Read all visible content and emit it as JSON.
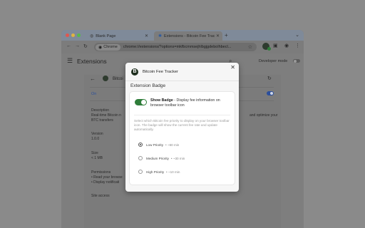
{
  "browser": {
    "tabs": [
      {
        "title": "Blank Page",
        "active": false
      },
      {
        "title": "Extensions - Bitcoin Fee Trac",
        "active": true
      }
    ],
    "url_chip": "Chrome",
    "url": "chrome://extensions/?options=mkfbcmmsejhlbgjgdebolhbecl..."
  },
  "extensions_page": {
    "title": "Extensions",
    "developer_mode_label": "Developer mode",
    "extension_name": "Bitcoi",
    "on_label": "On",
    "description_heading": "Description",
    "description_lines": [
      "Real-time Bitcoin n",
      "BTC transfers"
    ],
    "description_tail": "and optimize your",
    "version_heading": "Version",
    "version_value": "1.0.0",
    "size_heading": "Size",
    "size_value": "< 1 MB",
    "permissions_heading": "Permissions",
    "permissions": [
      "• Read your browse",
      "• Display notificati"
    ],
    "site_access_heading": "Site access"
  },
  "dialog": {
    "title": "Bitcoin Fee Tracker",
    "section_title": "Extension Badge",
    "show_badge_label": "Show Badge",
    "show_badge_desc": " - Display fee information on browser toolbar icon",
    "show_badge_enabled": true,
    "priority_desc": "Select which Bitcoin fee priority to display on your browser toolbar icon. The badge will show the current fee rate and update automatically.",
    "options": [
      {
        "label": "Low Priority",
        "time": "~60 min",
        "selected": true
      },
      {
        "label": "Medium Priority",
        "time": "~30 min",
        "selected": false
      },
      {
        "label": "High Priority",
        "time": "~10 min",
        "selected": false
      }
    ]
  },
  "colors": {
    "accent_green": "#2f7d3a",
    "link_blue": "#2c4f9c"
  }
}
